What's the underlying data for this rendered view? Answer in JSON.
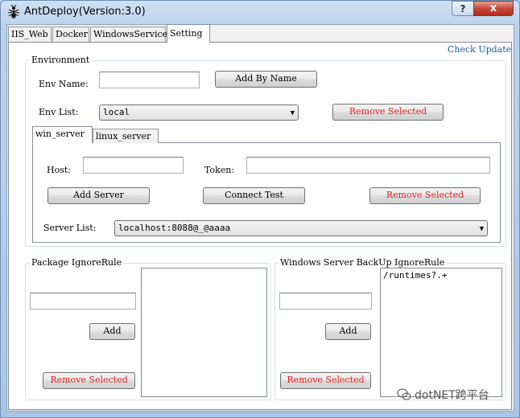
{
  "window": {
    "title": "AntDeploy(Version:3.0)",
    "help_label": "?",
    "close_label": "x"
  },
  "tabs": [
    "IIS_Web",
    "Docker",
    "WindowsService",
    "Setting"
  ],
  "active_tab": "Setting",
  "check_update": "Check Update",
  "environment": {
    "group_label": "Environment",
    "env_name_label": "Env Name:",
    "env_name_value": "",
    "add_by_name_label": "Add By Name",
    "env_list_label": "Env List:",
    "env_list_selected": "local",
    "remove_selected_label": "Remove Selected"
  },
  "server_tabs": [
    "win_server",
    "linux_server"
  ],
  "server": {
    "host_label": "Host:",
    "host_value": "",
    "token_label": "Token:",
    "token_value": "",
    "add_server_label": "Add Server",
    "connect_test_label": "Connect Test",
    "remove_selected_label": "Remove Selected",
    "server_list_label": "Server List:",
    "server_list_selected": "localhost:8088@_@aaaa"
  },
  "package_ignore": {
    "group_label": "Package IgnoreRule",
    "input_value": "",
    "add_label": "Add",
    "remove_selected_label": "Remove Selected",
    "items": []
  },
  "backup_ignore": {
    "group_label": "Windows Server BackUp IgnoreRule",
    "input_value": "",
    "add_label": "Add",
    "remove_selected_label": "Remove Selected",
    "items": [
      "/runtimes?.+"
    ]
  },
  "watermark": "dotNET跨平台",
  "colors": {
    "danger": "#e81e1e",
    "link": "#1f5c9e",
    "titlebar": "#bcd3ec"
  }
}
